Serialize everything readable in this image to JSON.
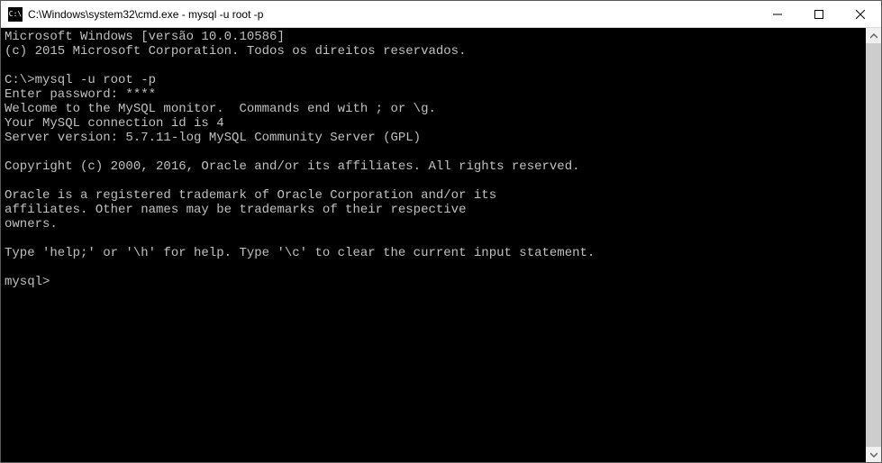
{
  "window": {
    "icon_label": "C:\\",
    "title": "C:\\Windows\\system32\\cmd.exe - mysql  -u root -p"
  },
  "terminal": {
    "lines": [
      "Microsoft Windows [versão 10.0.10586]",
      "(c) 2015 Microsoft Corporation. Todos os direitos reservados.",
      "",
      "C:\\>mysql -u root -p",
      "Enter password: ****",
      "Welcome to the MySQL monitor.  Commands end with ; or \\g.",
      "Your MySQL connection id is 4",
      "Server version: 5.7.11-log MySQL Community Server (GPL)",
      "",
      "Copyright (c) 2000, 2016, Oracle and/or its affiliates. All rights reserved.",
      "",
      "Oracle is a registered trademark of Oracle Corporation and/or its",
      "affiliates. Other names may be trademarks of their respective",
      "owners.",
      "",
      "Type 'help;' or '\\h' for help. Type '\\c' to clear the current input statement.",
      "",
      "mysql>"
    ]
  }
}
